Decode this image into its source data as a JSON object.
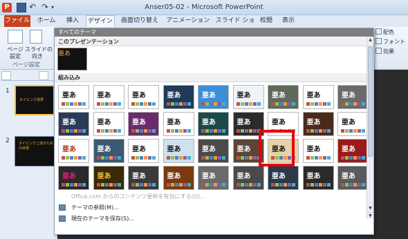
{
  "title_bar": {
    "title": "Anser05-02 - Microsoft PowerPoint",
    "app_logo": "P"
  },
  "qat": {
    "save_icon": "save-icon",
    "undo": "↶",
    "redo": "↷",
    "more": "▾"
  },
  "tabs": [
    "ファイル",
    "ホーム",
    "挿入",
    "デザイン",
    "画面切り替え",
    "アニメーション",
    "スライド ショー",
    "校閲",
    "表示"
  ],
  "active_tab": "デザイン",
  "ribbon": {
    "page_setup_label": "ページ\n設定",
    "orientation_label": "スライドの\n向き",
    "group_label": "ページ設定",
    "colors_label": "配色",
    "fonts_label": "フォント",
    "effects_label": "効果"
  },
  "slides": [
    {
      "number": "1",
      "title": "タイピング成果",
      "line2": ""
    },
    {
      "number": "2",
      "title": "タイピング上達のための目標",
      "line2": ""
    }
  ],
  "gallery": {
    "header": "すべてのテーマ",
    "this_presentation_label": "このプレゼンテーション",
    "builtin_label": "組み込み",
    "sample_glyph": "亜あ",
    "menu": {
      "enable_updates": "Office.com からのコンテンツ更新を有効にする(O)...",
      "browse_themes": "テーマの参照(M)...",
      "save_theme": "現在のテーマを保存(S)..."
    }
  },
  "colors": {
    "file_tab": "#c6421f",
    "accent_highlight": "#e8000b"
  }
}
